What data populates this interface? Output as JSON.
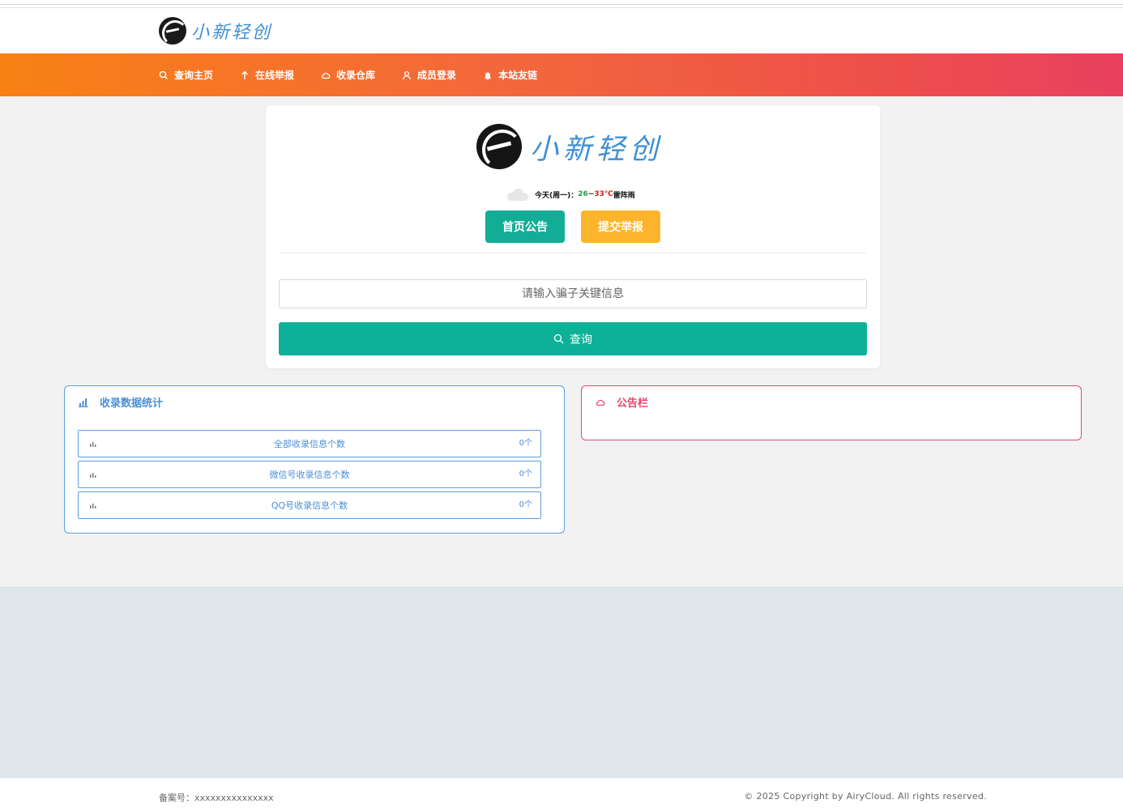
{
  "site": {
    "logo_text": "小新轻创"
  },
  "nav": {
    "items": [
      {
        "label": "查询主页",
        "icon": "search-icon"
      },
      {
        "label": "在线举报",
        "icon": "arrow-up-icon"
      },
      {
        "label": "收录仓库",
        "icon": "cloud-icon"
      },
      {
        "label": "成员登录",
        "icon": "user-icon"
      },
      {
        "label": "本站友链",
        "icon": "bell-icon"
      }
    ]
  },
  "main": {
    "logo_text": "小新轻创",
    "weather": {
      "prefix": "今天(周一)：",
      "low": "26",
      "sep": "~",
      "high": "33℃",
      "desc": "雷阵雨"
    },
    "notice_button": "首页公告",
    "report_button": "提交举报",
    "search_placeholder": "请输入骗子关键信息",
    "search_button": "查询"
  },
  "stats": {
    "title": "收录数据统计",
    "rows": [
      {
        "label": "全部收录信息个数",
        "count": "0个"
      },
      {
        "label": "微信号收录信息个数",
        "count": "0个"
      },
      {
        "label": "QQ号收录信息个数",
        "count": "0个"
      }
    ]
  },
  "notice_panel": {
    "title": "公告栏"
  },
  "footer": {
    "icp": "备案号：xxxxxxxxxxxxxxx",
    "copyright": "© 2025 Copyright by AiryCloud. All rights reserved."
  },
  "colors": {
    "nav_gradient_start": "#f98114",
    "nav_gradient_end": "#e8405f",
    "primary_green": "#0db197",
    "warning_yellow": "#fbb42b",
    "stats_blue": "#4a8fd8",
    "notice_red": "#e5476b"
  }
}
